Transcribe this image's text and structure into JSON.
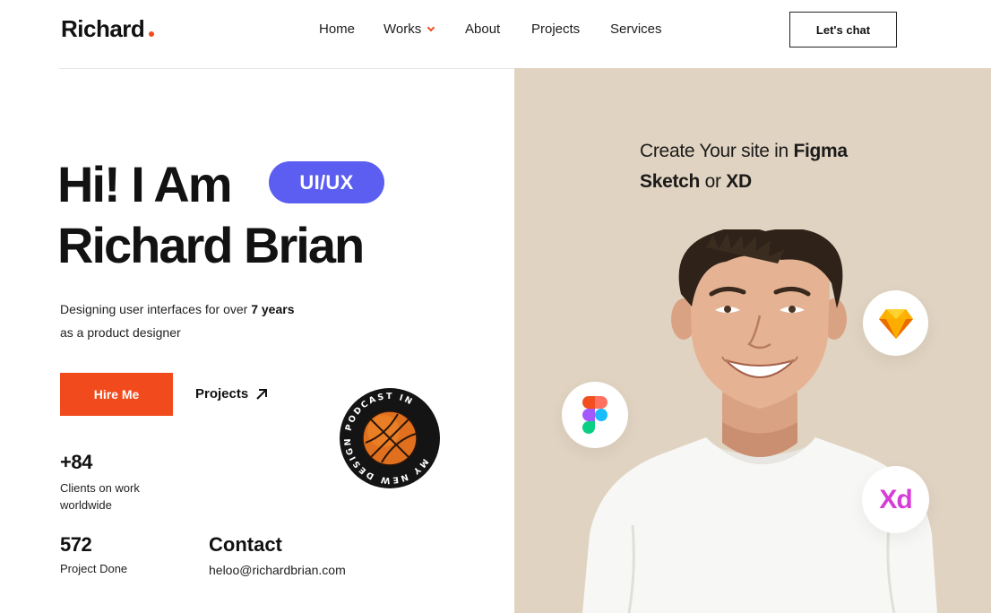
{
  "header": {
    "logo": "Richard",
    "nav": [
      {
        "label": "Home"
      },
      {
        "label": "Works"
      },
      {
        "label": "About"
      },
      {
        "label": "Projects"
      },
      {
        "label": "Services"
      }
    ],
    "cta_label": "Let's chat"
  },
  "hero": {
    "line1": "Hi! I Am",
    "badge": "UI/UX",
    "line2": "Richard Brian",
    "desc_part1": "Designing user interfaces for over ",
    "desc_bold": "7 years",
    "desc_part2": "as a product designer",
    "hire_label": "Hire Me",
    "projects_label": "Projects",
    "podcast_text": "MY NEW DESIGN PODCAST IN "
  },
  "stats": [
    {
      "value": "+84",
      "label": "Clients on work worldwide"
    },
    {
      "value": "572",
      "label": "Project Done"
    }
  ],
  "contact": {
    "title": "Contact",
    "email": "heloo@richardbrian.com"
  },
  "right": {
    "tag_pre": "Create Your site in ",
    "tag_figma": "Figma",
    "tag_sketch": "Sketch",
    "tag_or": " or ",
    "tag_xd": "XD",
    "xd_logo": "Xd"
  },
  "colors": {
    "accent": "#f14a1d",
    "badge": "#5b5ef0",
    "panel": "#e1d3c1"
  },
  "icons": {
    "works_dropdown": "chevron-down-icon",
    "projects_link": "arrow-up-right-icon",
    "figma": "figma-icon",
    "sketch": "sketch-icon",
    "xd": "xd-icon",
    "podcast": "basketball-icon"
  }
}
